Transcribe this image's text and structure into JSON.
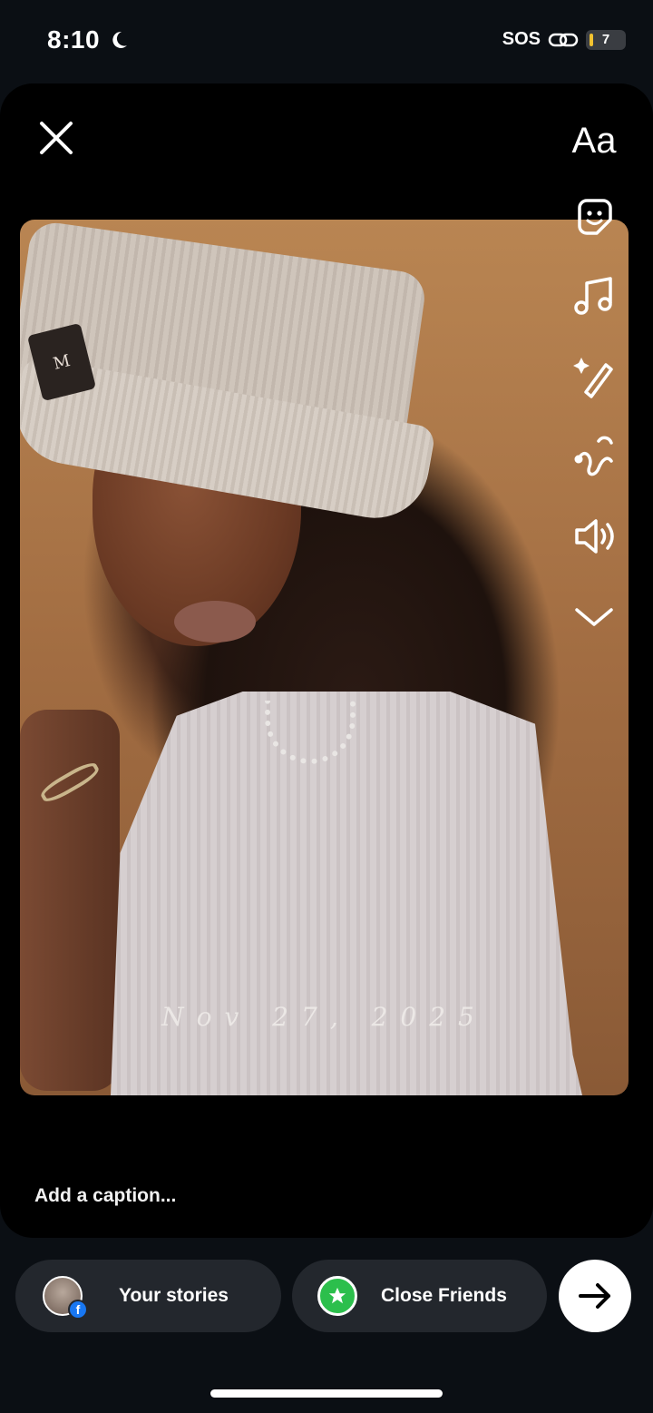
{
  "status_bar": {
    "time": "8:10",
    "carrier_text": "SOS",
    "battery_level": "7",
    "moon_icon": "moon-icon",
    "link_icon": "link-icon"
  },
  "editor": {
    "close_icon": "close-icon",
    "tools": {
      "text_label": "Aa",
      "icons": [
        "text-icon",
        "sticker-icon",
        "music-icon",
        "effects-icon",
        "draw-icon",
        "sound-icon",
        "chevron-down-icon"
      ]
    },
    "photo": {
      "date_stamp": "Nov 27, 2025",
      "hat_patch_text": "M"
    },
    "caption_placeholder": "Add a caption..."
  },
  "bottom_bar": {
    "your_stories_label": "Your stories",
    "close_friends_label": "Close Friends",
    "fb_badge_text": "f",
    "send_icon": "arrow-right-icon"
  },
  "colors": {
    "background": "#0b0f14",
    "pill": "#23272d",
    "close_friends_green": "#2cbf4c",
    "facebook_blue": "#1877f2",
    "battery_yellow": "#f2c230"
  }
}
